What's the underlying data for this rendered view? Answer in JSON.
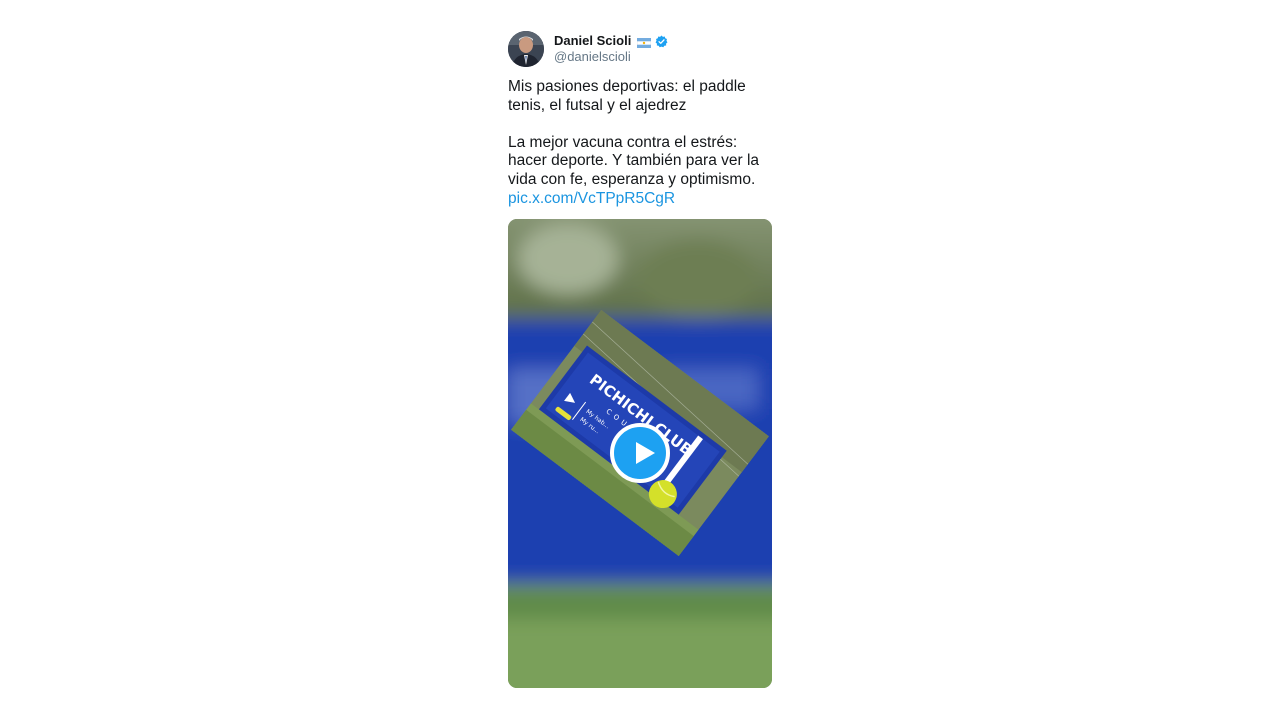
{
  "tweet": {
    "author": {
      "display_name": "Daniel Scioli",
      "handle": "@danielscioli",
      "flag_icon": "argentina-flag-icon",
      "verified_icon": "verified-badge-icon",
      "verified_color": "#1da1f2"
    },
    "text_paragraph_1": "Mis pasiones deportivas: el paddle tenis, el futsal y el ajedrez",
    "text_paragraph_2": "La mejor vacuna contra el estrés: hacer deporte. Y también para ver la vida con fe, esperanza y optimismo.",
    "link_text": "pic.x.com/VcTPpR5CgR",
    "link_color": "#1b95e0",
    "media": {
      "type": "video",
      "play_icon": "play-icon",
      "sign_text": "PICHICHI CLUB",
      "sign_subtext": "COURT",
      "sign_lines": [
        "My hab...",
        "My ru..."
      ]
    }
  }
}
